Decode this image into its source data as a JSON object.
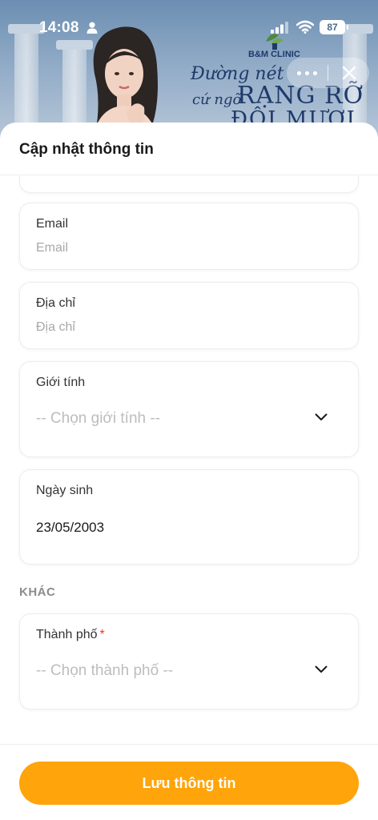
{
  "status_bar": {
    "time": "14:08",
    "battery": "87"
  },
  "banner": {
    "brand": "B&M CLINIC",
    "slogan_line1": "Đường nét",
    "slogan_line2": "cứ ngỡ",
    "slogan_line3": "RẠNG RỠ",
    "slogan_line4": "ĐÔI MƯƠI",
    "colors": {
      "sky": "#7b9abb",
      "text": "#1e3a6b"
    }
  },
  "capsule": {
    "more_icon": "more-dots-icon",
    "close_icon": "close-icon"
  },
  "sheet": {
    "title": "Cập nhật thông tin"
  },
  "form": {
    "email": {
      "label": "Email",
      "placeholder": "Email",
      "value": ""
    },
    "address": {
      "label": "Địa chỉ",
      "placeholder": "Địa chỉ",
      "value": ""
    },
    "gender": {
      "label": "Giới tính",
      "placeholder": "-- Chọn giới tính --"
    },
    "birthday": {
      "label": "Ngày sinh",
      "value": "23/05/2003"
    },
    "section_other": "KHÁC",
    "city": {
      "label": "Thành phố",
      "required_mark": "*",
      "placeholder": "-- Chọn thành phố --"
    }
  },
  "footer": {
    "save_label": "Lưu thông tin",
    "accent": "#ffa40a"
  }
}
